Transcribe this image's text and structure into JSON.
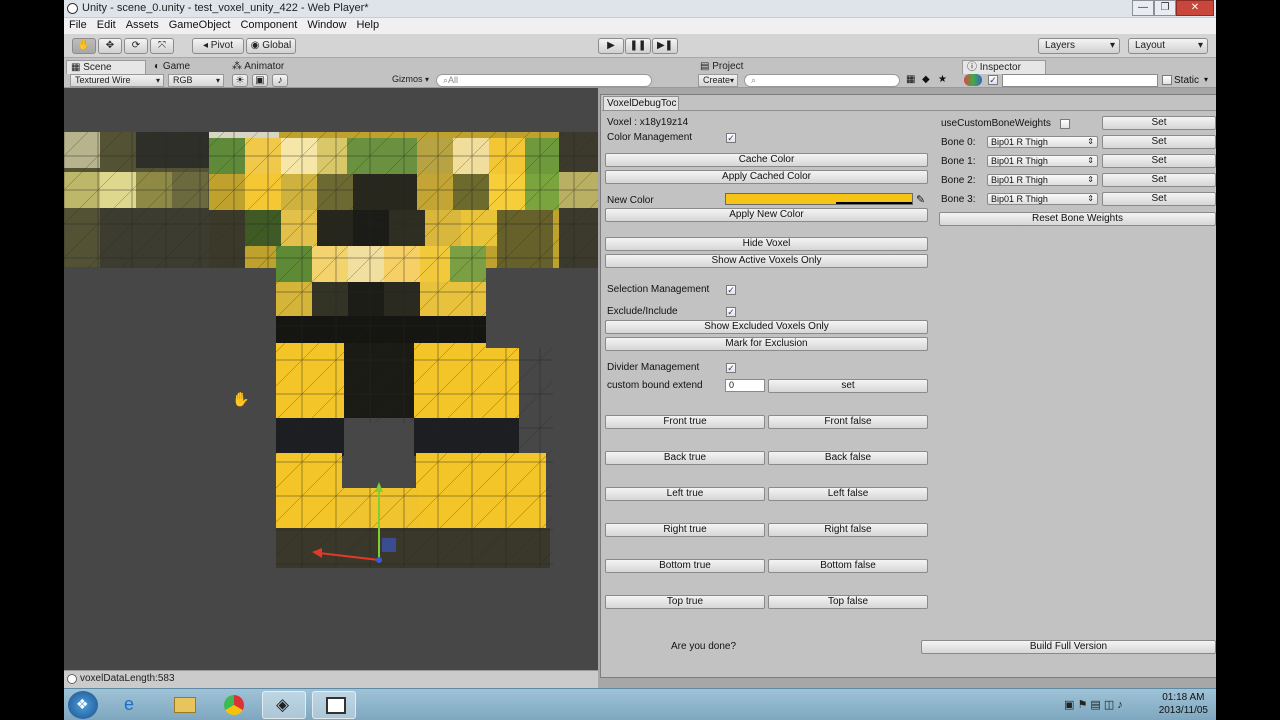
{
  "window": {
    "title": "Unity - scene_0.unity - test_voxel_unity_422 - Web Player*"
  },
  "menu": [
    "File",
    "Edit",
    "Assets",
    "GameObject",
    "Component",
    "Window",
    "Help"
  ],
  "toolbar": {
    "pivot": "Pivot",
    "global": "Global",
    "layers": "Layers",
    "layout": "Layout"
  },
  "tabs": {
    "scene": "Scene",
    "game": "Game",
    "animator": "Animator",
    "project": "Project",
    "inspector": "Inspector"
  },
  "scene_bar": {
    "shading": "Textured Wire",
    "render": "RGB",
    "gizmos": "Gizmos",
    "search_placeholder": "All"
  },
  "project_bar": {
    "create": "Create"
  },
  "inspector_bar": {
    "static": "Static"
  },
  "status": {
    "text": "voxelDataLength:583"
  },
  "tool": {
    "tab": "VoxelDebugToc",
    "voxel": "Voxel : x18y19z14",
    "color_management": "Color Management",
    "cache_color": "Cache Color",
    "apply_cached_color": "Apply Cached Color",
    "new_color": "New Color",
    "new_color_value": "#f6c417",
    "apply_new_color": "Apply New Color",
    "hide_voxel": "Hide Voxel",
    "show_active": "Show Active Voxels Only",
    "selection_management": "Selection Management",
    "exclude_include": "Exclude/Include",
    "show_excluded": "Show Excluded Voxels Only",
    "mark_exclusion": "Mark for Exclusion",
    "divider_management": "Divider Management",
    "custom_bound": "custom bound extend",
    "custom_bound_value": "0",
    "set": "set",
    "dirs": [
      {
        "t": "Front true",
        "f": "Front false"
      },
      {
        "t": "Back true",
        "f": "Back false"
      },
      {
        "t": "Left true",
        "f": "Left false"
      },
      {
        "t": "Right true",
        "f": "Right false"
      },
      {
        "t": "Bottom true",
        "f": "Bottom false"
      },
      {
        "t": "Top true",
        "f": "Top false"
      }
    ],
    "done": "Are you done?",
    "build": "Build Full Version",
    "use_custom": "useCustomBoneWeights",
    "bones": [
      {
        "label": "Bone 0:",
        "value": "Bip01 R Thigh",
        "btn": "Set"
      },
      {
        "label": "Bone 1:",
        "value": "Bip01 R Thigh",
        "btn": "Set"
      },
      {
        "label": "Bone 2:",
        "value": "Bip01 R Thigh",
        "btn": "Set"
      },
      {
        "label": "Bone 3:",
        "value": "Bip01 R Thigh",
        "btn": "Set"
      }
    ],
    "bone_set_top": "Set",
    "reset_bones": "Reset Bone Weights",
    "check_mark": "✓"
  },
  "clock": {
    "time": "01:18 AM",
    "date": "2013/11/05"
  }
}
